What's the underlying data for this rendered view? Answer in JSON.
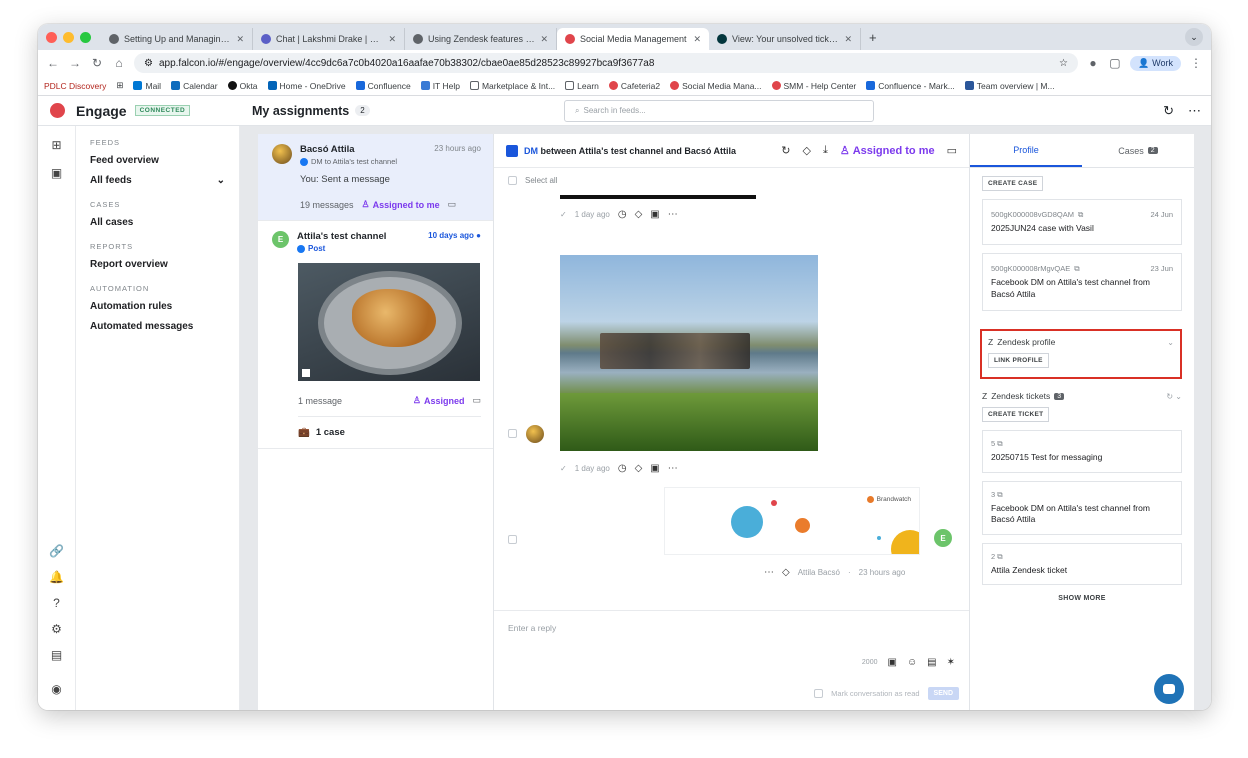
{
  "browser": {
    "tabs": [
      {
        "label": "Setting Up and Managing a Z",
        "color": "#5f6368",
        "active": false
      },
      {
        "label": "Chat | Lakshmi Drake | Micro",
        "color": "#5b5fc7",
        "active": false
      },
      {
        "label": "Using Zendesk features in E",
        "color": "#5f6368",
        "active": false
      },
      {
        "label": "Social Media Management",
        "color": "#e0454b",
        "active": true
      },
      {
        "label": "View: Your unsolved tickets -",
        "color": "#03363d",
        "active": false
      }
    ],
    "url": "app.falcon.io/#/engage/overview/4cc9dc6a7c0b4020a16aafae70b38302/cbae0ae85d28523c89927bca9f3677a8",
    "profile": "Work",
    "bookmarks": [
      "PDLC Discovery",
      "Mail",
      "Calendar",
      "Okta",
      "Home - OneDrive",
      "Confluence",
      "IT Help",
      "Marketplace & Int...",
      "Learn",
      "Cafeteria2",
      "Social Media Mana...",
      "SMM - Help Center",
      "Confluence - Mark...",
      "Team overview | M..."
    ]
  },
  "app": {
    "name": "Engage",
    "status": "CONNECTED",
    "page_title": "My assignments",
    "page_count": "2",
    "search_placeholder": "Search in feeds..."
  },
  "sidenav": {
    "feeds_heading": "FEEDS",
    "feed_overview": "Feed overview",
    "all_feeds": "All feeds",
    "cases_heading": "CASES",
    "all_cases": "All cases",
    "reports_heading": "REPORTS",
    "report_overview": "Report overview",
    "automation_heading": "AUTOMATION",
    "automation_rules": "Automation rules",
    "automated_messages": "Automated messages"
  },
  "conversations": [
    {
      "name": "Bacsó Attila",
      "time": "23 hours ago",
      "sub": "DM to Attila's test channel",
      "last_message": "You: Sent a message",
      "count": "19 messages",
      "assigned": "Assigned to me"
    },
    {
      "avatar": "E",
      "name": "Attila's test channel",
      "time": "10 days ago",
      "type": "Post",
      "count": "1 message",
      "assigned": "Assigned",
      "cases": "1 case"
    }
  ],
  "thread": {
    "title_prefix": "DM",
    "title": "between Attila's test channel and Bacsó Attila",
    "assigned": "Assigned to me",
    "select_all": "Select all",
    "msg_time": "1 day ago",
    "brand_label": "Brandwatch",
    "out_sender": "Attila Bacsó",
    "out_time": "23 hours ago",
    "out_avatar": "E",
    "reply_placeholder": "Enter a reply",
    "char_count": "2000",
    "mark_read": "Mark conversation as read",
    "send": "SEND"
  },
  "right_panel": {
    "tab_profile": "Profile",
    "tab_cases": "Cases",
    "cases_count": "2",
    "create_case": "CREATE CASE",
    "cases": [
      {
        "id": "500gK000008vGD8QAM",
        "date": "24 Jun",
        "title": "2025JUN24 case with Vasil"
      },
      {
        "id": "500gK000008rMgvQAE",
        "date": "23 Jun",
        "title": "Facebook DM on Attila's test channel from Bacsó Attila"
      }
    ],
    "zendesk_profile": "Zendesk profile",
    "link_profile": "LINK PROFILE",
    "zendesk_tickets": "Zendesk tickets",
    "tickets_count": "3",
    "create_ticket": "CREATE TICKET",
    "tickets": [
      {
        "num": "5",
        "subject": "20250715 Test for messaging"
      },
      {
        "num": "3",
        "subject": "Facebook DM on Attila's test channel from Bacsó Attila"
      },
      {
        "num": "2",
        "subject": "Attila Zendesk ticket"
      }
    ],
    "show_more": "SHOW MORE"
  }
}
